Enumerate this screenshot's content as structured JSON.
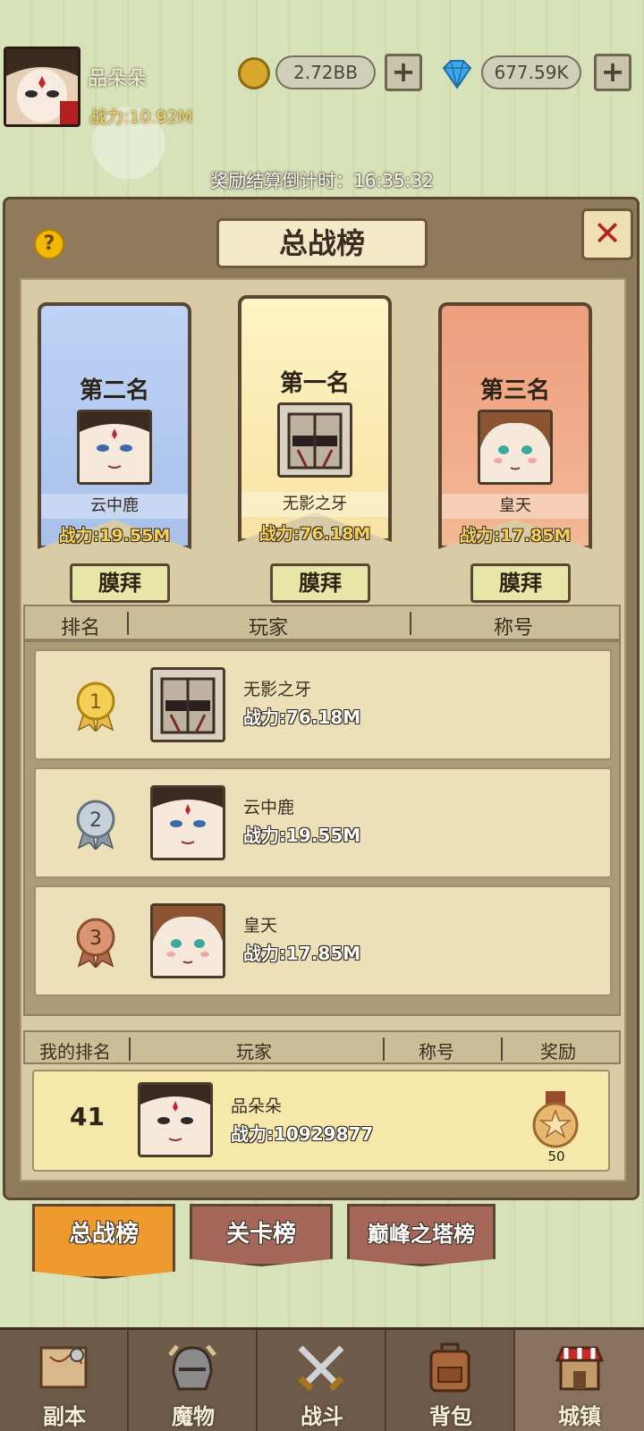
{
  "hud": {
    "player_name": "品朵朵",
    "player_power": "战力:10.92M",
    "gold": "2.72BB",
    "gems": "677.59K",
    "plus": "+"
  },
  "countdown": "奖励结算倒计时：16:35:32",
  "panel": {
    "title": "总战榜",
    "help": "?",
    "close": "✕"
  },
  "podium": [
    {
      "rank_label": "第二名",
      "name": "云中鹿",
      "power": "战力:19.55M",
      "worship": "膜拜"
    },
    {
      "rank_label": "第一名",
      "name": "无影之牙",
      "power": "战力:76.18M",
      "worship": "膜拜"
    },
    {
      "rank_label": "第三名",
      "name": "皇天",
      "power": "战力:17.85M",
      "worship": "膜拜"
    }
  ],
  "table_header": {
    "rank": "排名",
    "player": "玩家",
    "title": "称号"
  },
  "rows": [
    {
      "rank": "1",
      "name": "无影之牙",
      "power": "战力:76.18M"
    },
    {
      "rank": "2",
      "name": "云中鹿",
      "power": "战力:19.55M"
    },
    {
      "rank": "3",
      "name": "皇天",
      "power": "战力:17.85M"
    }
  ],
  "my_header": {
    "rank": "我的排名",
    "player": "玩家",
    "title": "称号",
    "reward": "奖励"
  },
  "my_row": {
    "rank": "41",
    "name": "品朵朵",
    "power": "战力:10929877",
    "reward_count": "50"
  },
  "tabs": [
    "总战榜",
    "关卡榜",
    "巅峰之塔榜"
  ],
  "nav": [
    "副本",
    "魔物",
    "战斗",
    "背包",
    "城镇"
  ],
  "colors": {
    "gold_text": "#f4d154",
    "close_red": "#b5221f",
    "active_tab": "#ee9a2e"
  }
}
